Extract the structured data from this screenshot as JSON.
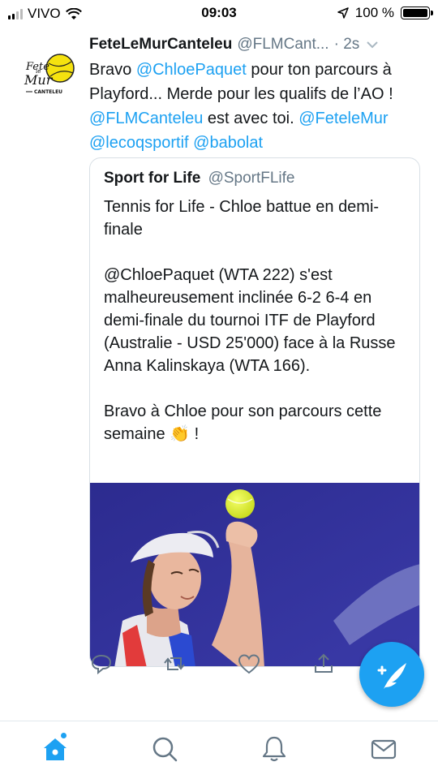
{
  "status_bar": {
    "carrier": "VIVO",
    "time": "09:03",
    "battery": "100 %"
  },
  "tweet": {
    "author_name": "FeteLeMurCanteleu",
    "author_handle": "@FLMCant...",
    "time": "2s",
    "avatar_logo_text": "Fete le Mur",
    "avatar_subtitle": "CANTELEU",
    "text": {
      "t1": "Bravo ",
      "m1": "@ChloePaquet",
      "t2": " pour ton parcours à Playford... Merde pour les qualifs de l’AO ! ",
      "m2": "@FLMCanteleu",
      "t3": " est avec toi. ",
      "m3": "@FeteleMur",
      "t4": " ",
      "m4": "@lecoqsportif",
      "t5": " ",
      "m5": "@babolat"
    }
  },
  "quote": {
    "author_name": "Sport for Life",
    "author_handle": "@SportFLife",
    "text": "Tennis for Life - Chloe battue en demi-finale\n\n@ChloePaquet (WTA 222) s'est malheureusement inclinée 6-2 6-4 en demi-finale du tournoi ITF de Playford (Australie - USD 25'000) face à la Russe Anna Kalinskaya (WTA 166).\n\nBravo à Chloe pour son parcours cette semaine 👏 !",
    "image_icon": "tennis-player-serving-photo"
  },
  "actions": [
    "reply-icon",
    "retweet-icon",
    "like-icon",
    "share-icon"
  ],
  "fab_icon": "compose-tweet-icon",
  "tab_bar": [
    "home-icon",
    "search-icon",
    "notifications-icon",
    "messages-icon"
  ],
  "colors": {
    "accent": "#1da1f2",
    "text": "#14171a",
    "muted": "#657786",
    "border": "#d8dfe5"
  }
}
